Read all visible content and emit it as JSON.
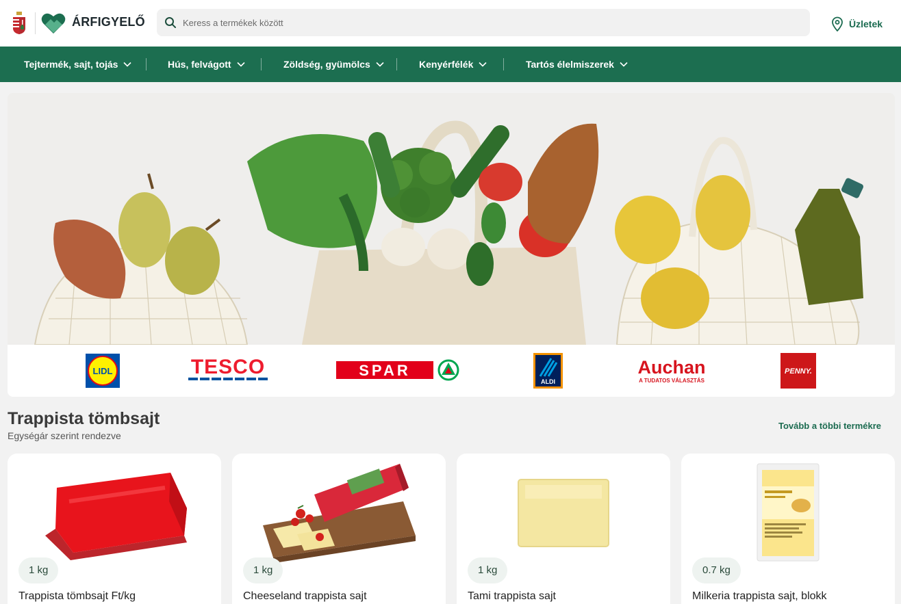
{
  "header": {
    "brand": "ÁRFIGYELŐ",
    "search_placeholder": "Keress a termékek között",
    "stores_label": "Üzletek"
  },
  "nav": [
    {
      "label": "Tejtermék, sajt, tojás"
    },
    {
      "label": "Hús, felvágott"
    },
    {
      "label": "Zöldség, gyümölcs"
    },
    {
      "label": "Kenyérfélék"
    },
    {
      "label": "Tartós élelmiszerek"
    }
  ],
  "stores": [
    {
      "name": "LIDL",
      "color": "#0050aa"
    },
    {
      "name": "TESCO",
      "color": "#ee1c2e"
    },
    {
      "name": "SPAR",
      "color": "#e2001a"
    },
    {
      "name": "ALDI",
      "color": "#00205b"
    },
    {
      "name": "Auchan",
      "tagline": "A TUDATOS VÁLASZTÁS",
      "color": "#d7141e"
    },
    {
      "name": "PENNY.",
      "color": "#cd1719"
    }
  ],
  "section": {
    "title": "Trappista tömbsajt",
    "subtitle": "Egységár szerint rendezve",
    "more_link": "Tovább a többi termékre"
  },
  "products": [
    {
      "unit": "1 kg",
      "name": "Trappista tömbsajt Ft/kg"
    },
    {
      "unit": "1 kg",
      "name": "Cheeseland trappista sajt"
    },
    {
      "unit": "1 kg",
      "name": "Tami trappista sajt"
    },
    {
      "unit": "0.7 kg",
      "name": "Milkeria trappista sajt, blokk"
    }
  ],
  "colors": {
    "brand_green": "#1c6e50",
    "page_bg": "#f2f2f2"
  }
}
